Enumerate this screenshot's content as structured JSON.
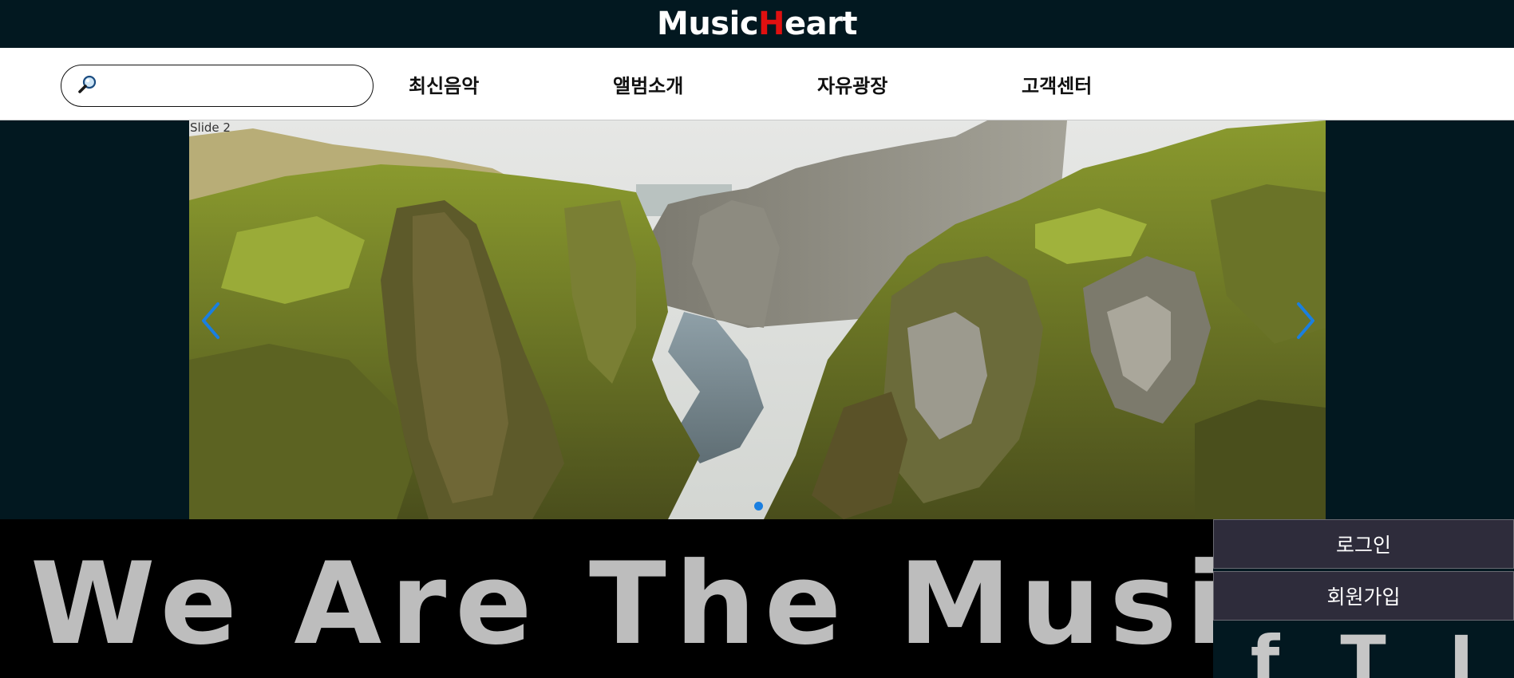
{
  "header": {
    "logo_part1": "Music",
    "logo_accent": "H",
    "logo_part2": "eart"
  },
  "nav": {
    "search": {
      "icon": "search-icon",
      "value": "",
      "placeholder": ""
    },
    "items": [
      {
        "label": "최신음악"
      },
      {
        "label": "앨범소개"
      },
      {
        "label": "자유광장"
      },
      {
        "label": "고객센터"
      }
    ]
  },
  "slider": {
    "label": "Slide 2",
    "prev_icon": "chevron-left-icon",
    "next_icon": "chevron-right-icon",
    "pagination_dots": 1,
    "active_dot": 1,
    "image": "mossy canyon landscape with river"
  },
  "banner": {
    "text": "We Are The Music!"
  },
  "side": {
    "login_label": "로그인",
    "signup_label": "회원가입",
    "social": [
      {
        "label": "f",
        "icon": "facebook-icon"
      },
      {
        "label": "T",
        "icon": "twitter-icon"
      },
      {
        "label": "I",
        "icon": "instagram-icon"
      }
    ]
  },
  "colors": {
    "background": "#021820",
    "logo_accent": "#e01010",
    "banner_text": "#bdbdbd",
    "button_bg": "#2e2c3b",
    "slider_arrow": "#1a7fe0"
  }
}
